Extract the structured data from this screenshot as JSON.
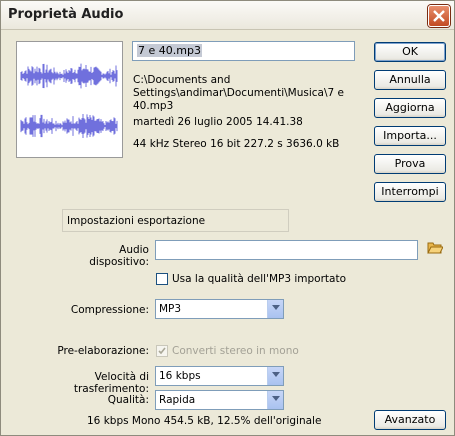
{
  "window": {
    "title": "Proprietà Audio"
  },
  "file": {
    "name": "7 e 40.mp3",
    "path_line1": "C:\\Documents and",
    "path_line2": "Settings\\andimar\\Documenti\\Musica\\7 e",
    "path_line3": "40.mp3",
    "date": "martedì 26 luglio 2005  14.41.38",
    "format": "44 kHz Stereo 16 bit 227.2 s 3636.0 kB"
  },
  "buttons": {
    "ok": "OK",
    "annulla": "Annulla",
    "aggiorna": "Aggiorna",
    "importa": "Importa...",
    "prova": "Prova",
    "interrompi": "Interrompi",
    "avanzato": "Avanzato"
  },
  "export": {
    "section": "Impostazioni esportazione",
    "device_label": "Audio dispositivo:",
    "device_value": "",
    "use_quality_label": "Usa la qualità dell'MP3 importato",
    "use_quality_checked": false,
    "compression_label": "Compressione:",
    "compression_value": "MP3",
    "preprocess_label": "Pre-elaborazione:",
    "preprocess_option": "Converti stereo in mono",
    "preprocess_checked": true,
    "bitrate_label": "Velocità di trasferimento:",
    "bitrate_value": "16 kbps",
    "quality_label": "Qualità:",
    "quality_value": "Rapida",
    "summary": "16 kbps  Mono 454.5 kB, 12.5% dell'originale"
  },
  "colors": {
    "waveform": "#7070dd",
    "titlebar_close": "#d0582e"
  }
}
